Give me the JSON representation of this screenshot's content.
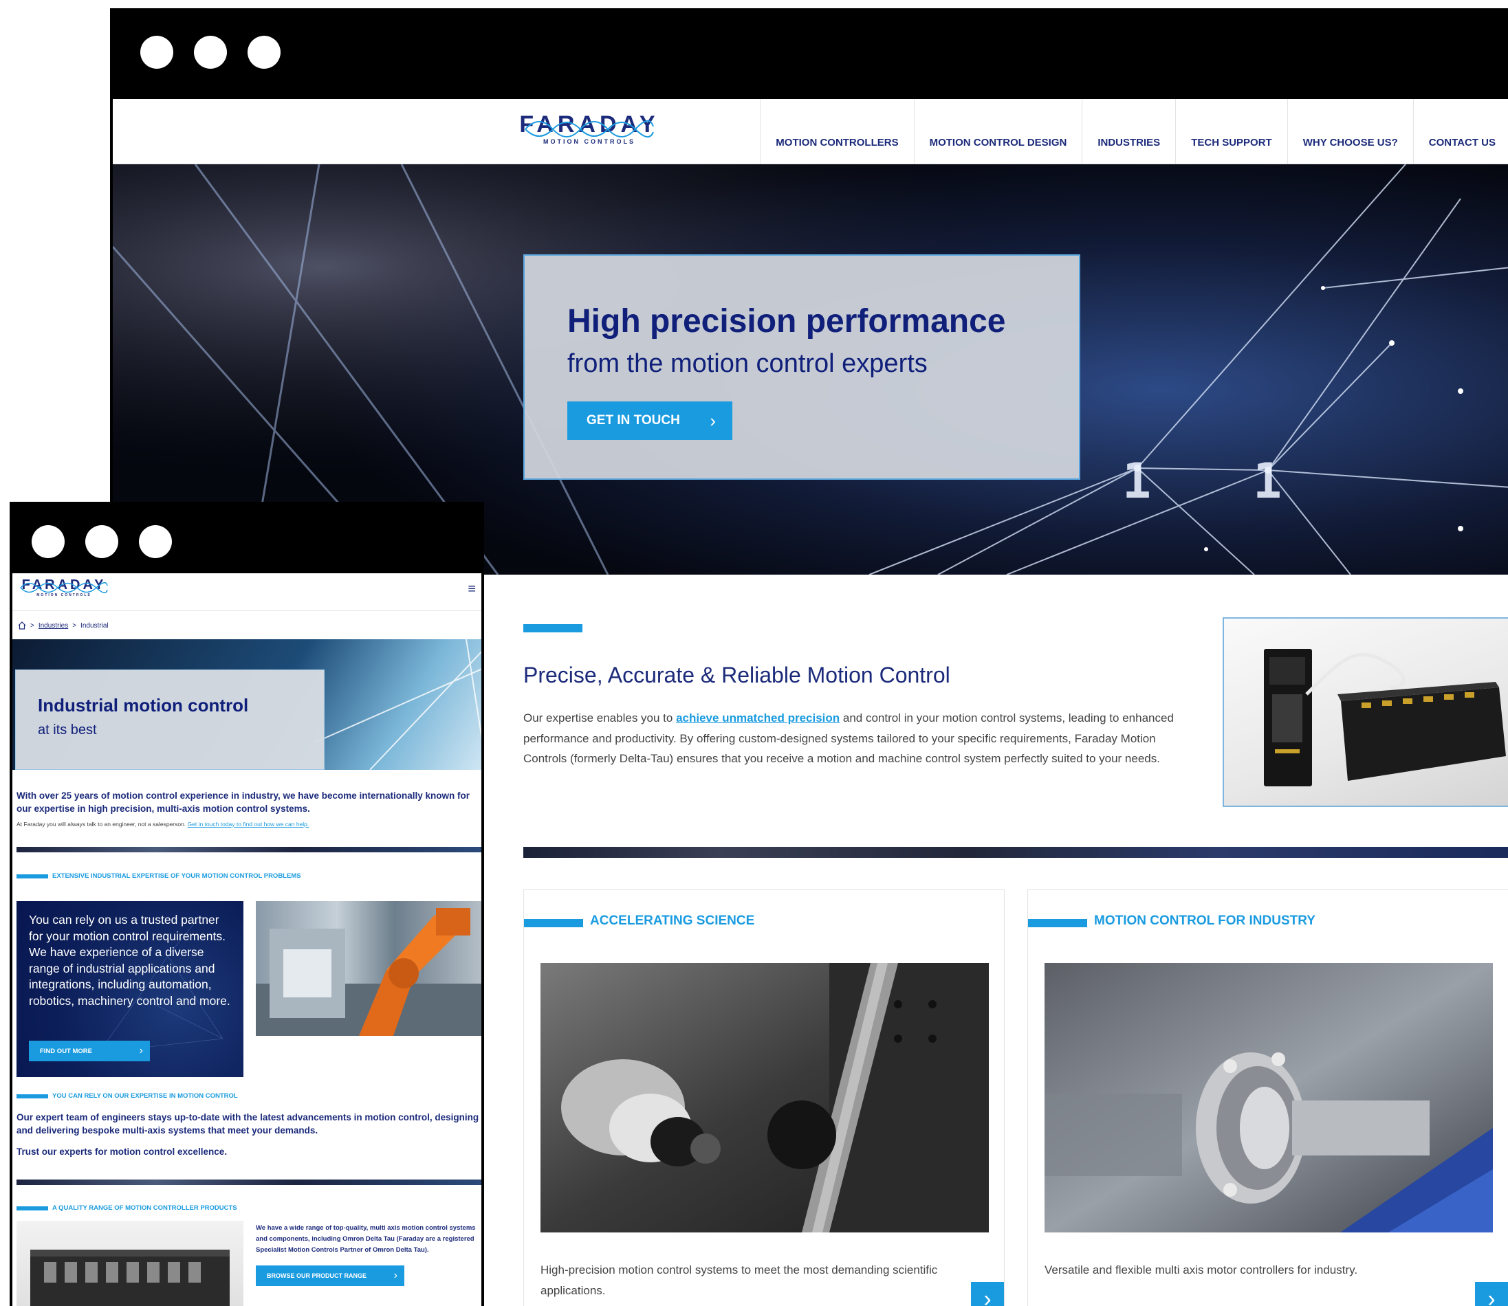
{
  "desktop": {
    "nav": {
      "logo_word": "FARADAY",
      "logo_sub": "MOTION CONTROLS",
      "items": [
        "MOTION CONTROLLERS",
        "MOTION CONTROL DESIGN",
        "INDUSTRIES",
        "TECH SUPPORT",
        "WHY CHOOSE US?",
        "CONTACT US"
      ]
    },
    "hero": {
      "title": "High precision performance",
      "subtitle": "from the motion control experts",
      "button": "GET IN TOUCH"
    },
    "intro": {
      "heading": "Precise, Accurate & Reliable Motion Control",
      "text_before": "Our expertise enables you to ",
      "link": "achieve unmatched precision",
      "text_after": " and control in your motion control systems, leading to enhanced performance and productivity. By offering custom-designed systems tailored to your specific requirements, Faraday Motion Controls (formerly Delta-Tau) ensures that you receive a motion and machine control system perfectly suited to your needs."
    },
    "cards": [
      {
        "title": "ACCELERATING SCIENCE",
        "desc": "High-precision motion control systems to meet the most demanding scientific applications."
      },
      {
        "title": "MOTION CONTROL FOR INDUSTRY",
        "desc": "Versatile and flexible multi axis motor controllers for industry."
      }
    ]
  },
  "mobile": {
    "logo_word": "FARADAY",
    "logo_sub": "MOTION CONTROLS",
    "breadcrumb": {
      "sep": ">",
      "parent": "Industries",
      "current": "Industrial"
    },
    "hero": {
      "title": "Industrial motion control",
      "subtitle": "at its best"
    },
    "intro": "With over 25 years of motion control experience in industry, we have become internationally known for our expertise in high precision, multi-axis motion control systems.",
    "intro2_text": "At Faraday you will always talk to an engineer, not a salesperson. ",
    "intro2_link": "Get in touch today to find out how we can help.",
    "section1_heading": "EXTENSIVE INDUSTRIAL EXPERTISE OF YOUR MOTION CONTROL PROBLEMS",
    "bluebox_text": "You can rely on us a trusted partner for your motion control requirements. We have experience of a diverse range of industrial applications and integrations, including automation, robotics, machinery control and more.",
    "bluebox_button": "FIND OUT MORE",
    "section2_heading": "YOU CAN RELY ON OUR EXPERTISE IN MOTION CONTROL",
    "section2_text": "Our expert team of engineers stays up-to-date with the latest advancements in motion control, designing and delivering bespoke multi-axis systems that meet your demands.",
    "section2_text2": "Trust our experts for motion control excellence.",
    "section3_heading": "A QUALITY RANGE OF MOTION CONTROLLER PRODUCTS",
    "product_text": "We have a wide range of top-quality, multi axis motion control systems and components, including Omron Delta Tau (Faraday are a registered Specialist  Motion Controls Partner of Omron Delta Tau).",
    "product_button": "BROWSE OUR PRODUCT RANGE"
  },
  "icons": {
    "chevron": "›",
    "hamburger": "≡",
    "home": "home-icon"
  },
  "colors": {
    "accent": "#1a9be0",
    "navy": "#1b2a7a"
  }
}
